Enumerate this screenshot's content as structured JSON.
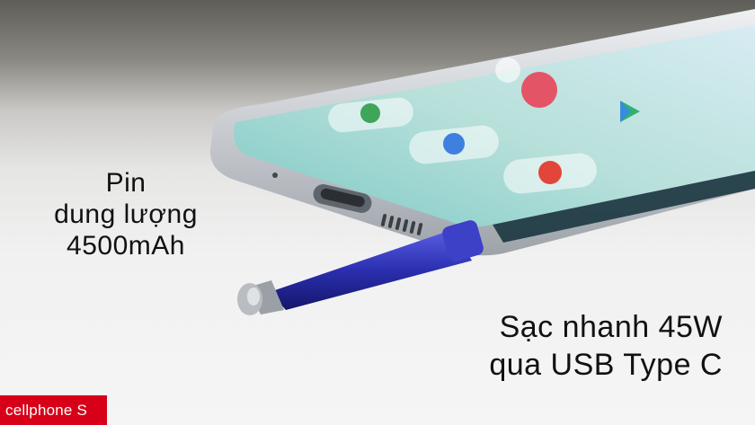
{
  "captions": {
    "battery": [
      "Pin",
      "dung lượng",
      "4500mAh"
    ],
    "charging": [
      "Sạc nhanh 45W",
      "qua USB Type C"
    ]
  },
  "brand": {
    "logo_text": "cellphone S"
  },
  "colors": {
    "brand": "#d70018",
    "pen": "#2b2fb0",
    "screen": "#9fd3cf"
  },
  "icons": [
    "phone-icon",
    "camera-icon",
    "play-store-icon",
    "messages-icon",
    "galaxy-store-icon"
  ]
}
